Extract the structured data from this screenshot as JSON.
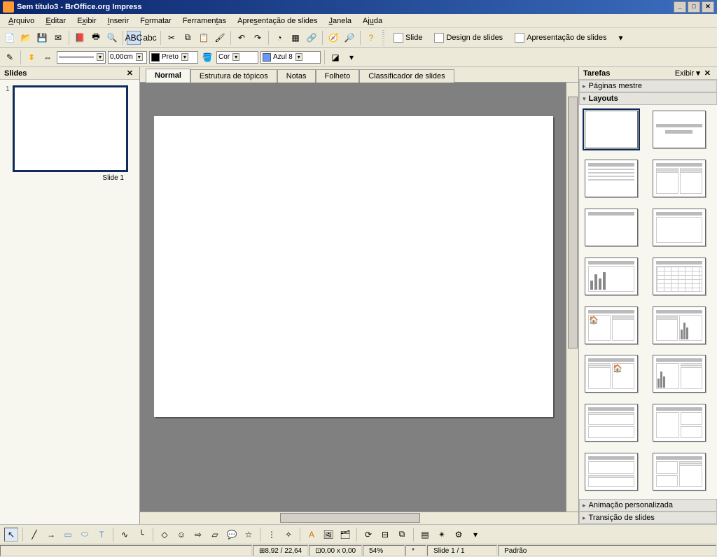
{
  "title": "Sem título3 - BrOffice.org Impress",
  "window_buttons": {
    "min": "_",
    "max": "□",
    "close": "✕"
  },
  "menu": [
    "Arquivo",
    "Editar",
    "Exibir",
    "Inserir",
    "Formatar",
    "Ferramentas",
    "Apresentação de slides",
    "Janela",
    "Ajuda"
  ],
  "toolbar2": {
    "line_width": "0,00cm",
    "color1": "Preto",
    "fill_type": "Cor",
    "color2": "Azul 8"
  },
  "ribbon": {
    "slide": "Slide",
    "design": "Design de slides",
    "presentation": "Apresentação de slides"
  },
  "slides_panel": {
    "title": "Slides",
    "items": [
      {
        "num": "1",
        "label": "Slide 1"
      }
    ]
  },
  "tabs": [
    "Normal",
    "Estrutura de tópicos",
    "Notas",
    "Folheto",
    "Classificador de slides"
  ],
  "active_tab": 0,
  "tasks_panel": {
    "title": "Tarefas",
    "view": "Exibir",
    "sections": {
      "master": "Páginas mestre",
      "layouts": "Layouts",
      "animation": "Animação personalizada",
      "transition": "Transição de slides"
    }
  },
  "status": {
    "pos": "8,92 / 22,64",
    "size": "0,00 x 0,00",
    "zoom": "54%",
    "modified": "*",
    "slide": "Slide 1 / 1",
    "default": "Padrão"
  }
}
